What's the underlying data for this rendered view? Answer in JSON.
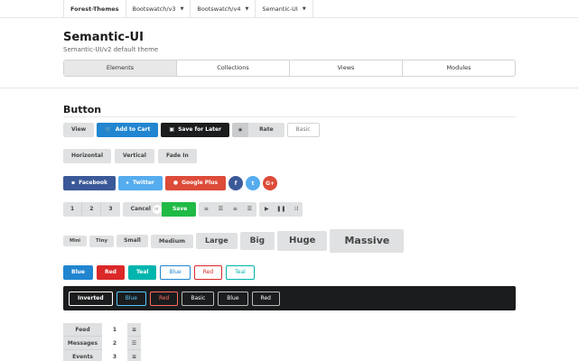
{
  "topnav": {
    "brand": "Forest-Themes",
    "items": [
      "Bootswatch/v3",
      "Bootswatch/v4",
      "Semantic-UI"
    ]
  },
  "header": {
    "title": "Semantic-UI",
    "subtitle": "Semantic-UI/v2 default theme"
  },
  "tabs": [
    "Elements",
    "Collections",
    "Views",
    "Modules"
  ],
  "section": {
    "title": "Button"
  },
  "row1": {
    "view": "View",
    "add_to_cart": "Add to Cart",
    "save_later": "Save for Later",
    "rate": "Rate",
    "basic": "Basic"
  },
  "row2": [
    "Horizontal",
    "Vertical",
    "Fade In"
  ],
  "row3": {
    "facebook": "Facebook",
    "twitter": "Twitter",
    "google": "Google Plus",
    "fb_short": "f",
    "tw_short": "t",
    "gp_short": "G+"
  },
  "row4": {
    "numbers": [
      "1",
      "2",
      "3"
    ],
    "cancel": "Cancel",
    "or": "or",
    "save": "Save"
  },
  "sizes": [
    "Mini",
    "Tiny",
    "Small",
    "Medium",
    "Large",
    "Big",
    "Huge",
    "Massive"
  ],
  "colors": [
    "Blue",
    "Red",
    "Teal",
    "Blue",
    "Red",
    "Teal"
  ],
  "inverted": [
    "Inverted",
    "Blue",
    "Red",
    "Basic",
    "Blue",
    "Red"
  ],
  "vertical": {
    "labels": [
      "Feed",
      "Messages",
      "Events"
    ],
    "numbers": [
      "1",
      "2",
      "3"
    ]
  },
  "theme_colors": {
    "blue": "#2185d0",
    "red": "#db2828",
    "teal": "#00b5ad",
    "green": "#21ba45",
    "black": "#1b1c1d"
  }
}
